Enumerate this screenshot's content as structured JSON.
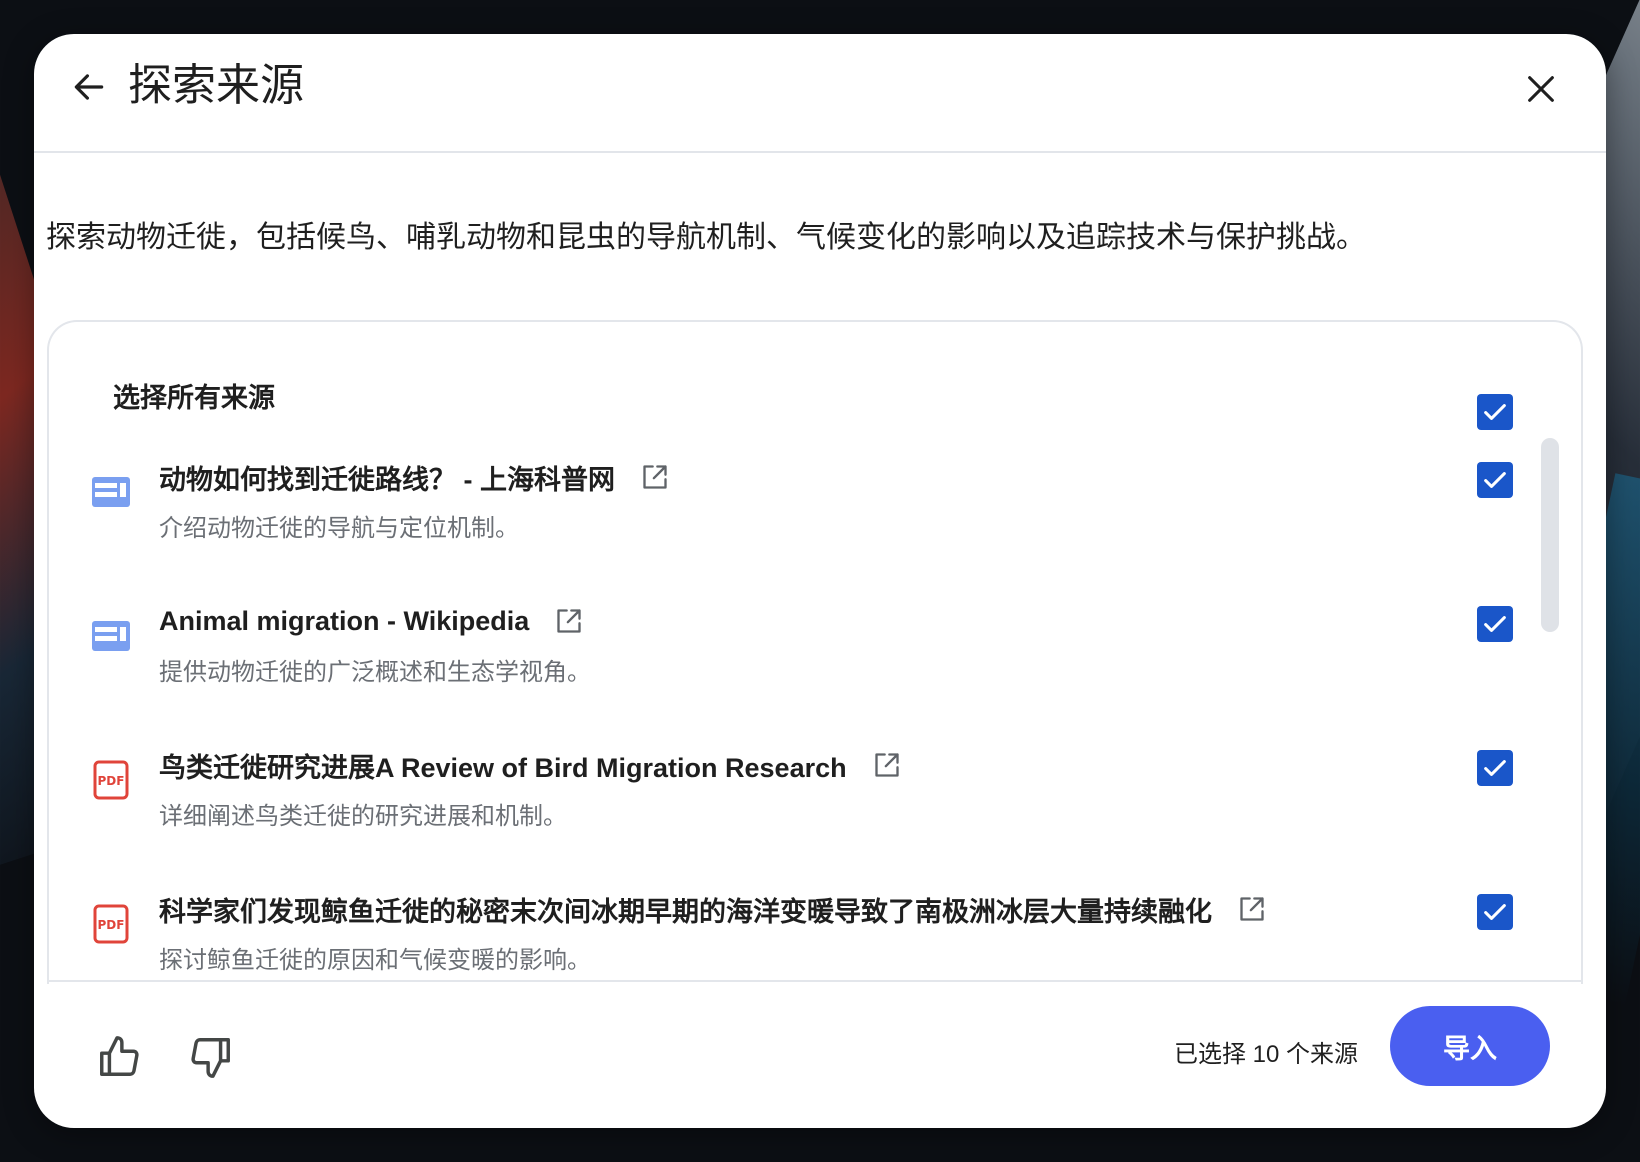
{
  "dialog": {
    "title": "探索来源",
    "description": "探索动物迁徙，包括候鸟、哺乳动物和昆虫的导航机制、气候变化的影响以及追踪技术与保护挑战。"
  },
  "select_all": {
    "label": "选择所有来源",
    "checked": true
  },
  "sources": [
    {
      "icon": "web-page-icon",
      "title": "动物如何找到迁徙路线？ - 上海科普网",
      "description": "介绍动物迁徙的导航与定位机制。",
      "checked": true
    },
    {
      "icon": "web-page-icon",
      "title": "Animal migration - Wikipedia",
      "description": "提供动物迁徙的广泛概述和生态学视角。",
      "checked": true
    },
    {
      "icon": "pdf-icon",
      "title": "鸟类迁徙研究进展A Review of Bird Migration Research",
      "description": "详细阐述鸟类迁徙的研究进展和机制。",
      "checked": true
    },
    {
      "icon": "pdf-icon",
      "title": "科学家们发现鲸鱼迁徙的秘密末次间冰期早期的海洋变暖导致了南极洲冰层大量持续融化",
      "description": "探讨鲸鱼迁徙的原因和气候变暖的影响。",
      "checked": true
    }
  ],
  "footer": {
    "selected_count": "已选择 10 个来源",
    "import_label": "导入"
  },
  "icons": {
    "pdf_label": "PDF"
  },
  "colors": {
    "checkbox": "#1a56c9",
    "import_button": "#4a5ff0",
    "web_icon": "#7a9ff0",
    "pdf_icon": "#e0443a"
  }
}
